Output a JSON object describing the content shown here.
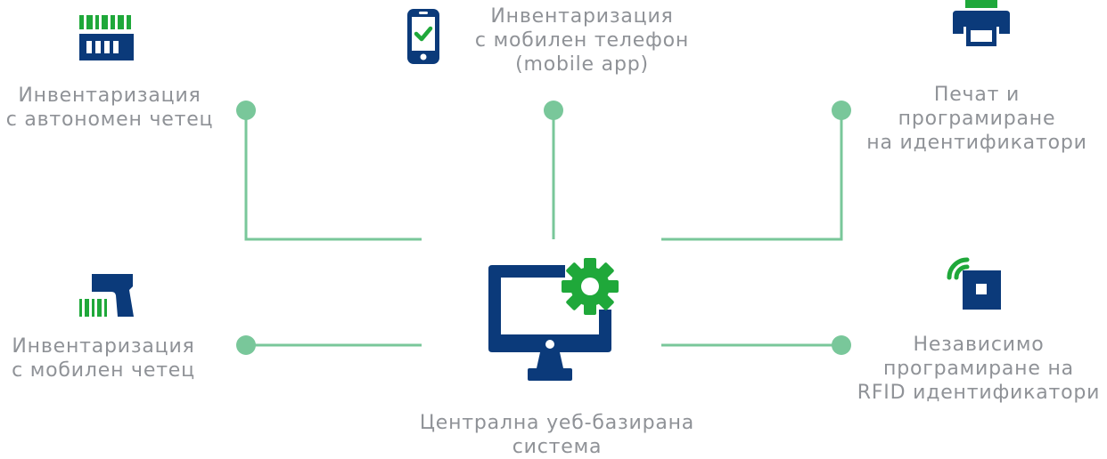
{
  "colors": {
    "navy": "#0b3a7a",
    "green": "#1fa83a",
    "connector": "#79c79a",
    "text": "#8f9297"
  },
  "nodes": {
    "standalone_reader": {
      "icon": "barcode-reader-icon",
      "lines": [
        "Инвентаризация",
        "с автономен четец"
      ]
    },
    "mobile_phone": {
      "icon": "smartphone-check-icon",
      "lines": [
        "Инвентаризация",
        "с мобилен телефон",
        "(mobile app)"
      ]
    },
    "printing": {
      "icon": "printer-icon",
      "lines": [
        "Печат и",
        "програмиране",
        "на идентификатори"
      ]
    },
    "mobile_reader": {
      "icon": "handheld-scanner-icon",
      "lines": [
        "Инвентаризация",
        "с мобилен четец"
      ]
    },
    "rfid_programming": {
      "icon": "rfid-tag-icon",
      "lines": [
        "Независимо",
        "програмиране на",
        "RFID идентификатори"
      ]
    },
    "central_system": {
      "icon": "monitor-gear-icon",
      "lines": [
        "Централна уеб-базирана",
        "система"
      ]
    }
  }
}
